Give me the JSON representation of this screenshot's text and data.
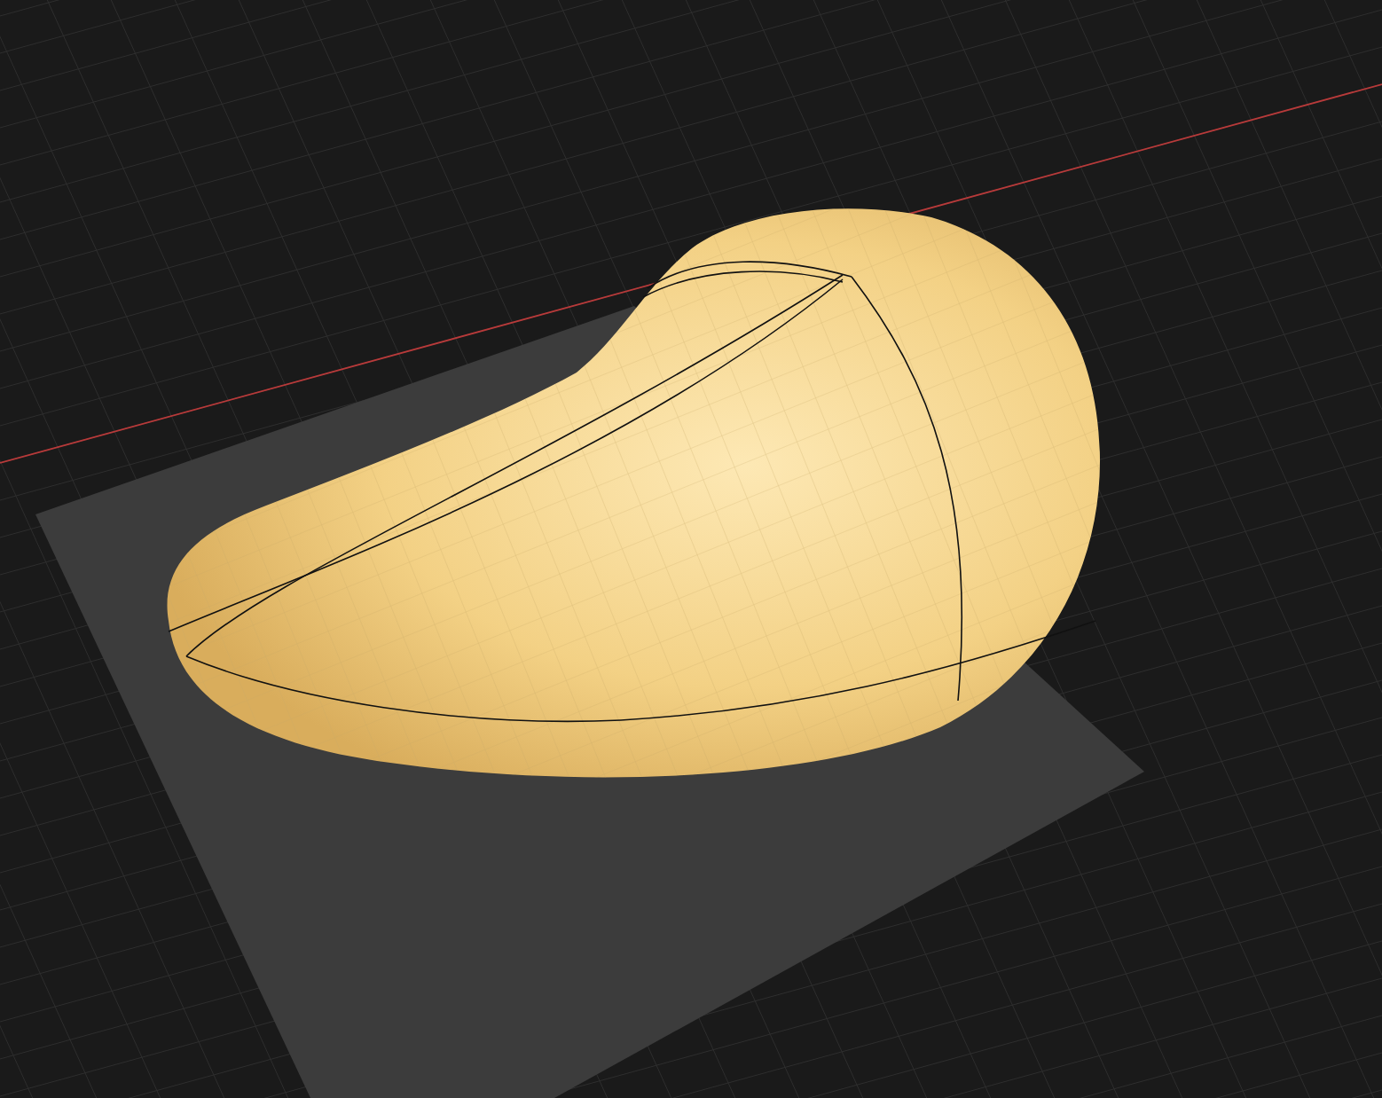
{
  "viewport": {
    "grid": true,
    "axis": true,
    "ground_plane": true
  }
}
